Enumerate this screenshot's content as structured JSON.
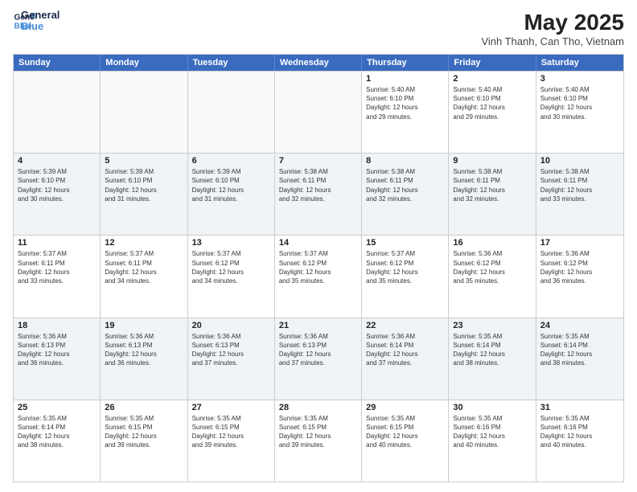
{
  "logo": {
    "line1": "General",
    "line2": "Blue"
  },
  "title": "May 2025",
  "subtitle": "Vinh Thanh, Can Tho, Vietnam",
  "day_headers": [
    "Sunday",
    "Monday",
    "Tuesday",
    "Wednesday",
    "Thursday",
    "Friday",
    "Saturday"
  ],
  "weeks": [
    [
      {
        "day": "",
        "detail": ""
      },
      {
        "day": "",
        "detail": ""
      },
      {
        "day": "",
        "detail": ""
      },
      {
        "day": "",
        "detail": ""
      },
      {
        "day": "1",
        "detail": "Sunrise: 5:40 AM\nSunset: 6:10 PM\nDaylight: 12 hours\nand 29 minutes."
      },
      {
        "day": "2",
        "detail": "Sunrise: 5:40 AM\nSunset: 6:10 PM\nDaylight: 12 hours\nand 29 minutes."
      },
      {
        "day": "3",
        "detail": "Sunrise: 5:40 AM\nSunset: 6:10 PM\nDaylight: 12 hours\nand 30 minutes."
      }
    ],
    [
      {
        "day": "4",
        "detail": "Sunrise: 5:39 AM\nSunset: 6:10 PM\nDaylight: 12 hours\nand 30 minutes."
      },
      {
        "day": "5",
        "detail": "Sunrise: 5:39 AM\nSunset: 6:10 PM\nDaylight: 12 hours\nand 31 minutes."
      },
      {
        "day": "6",
        "detail": "Sunrise: 5:39 AM\nSunset: 6:10 PM\nDaylight: 12 hours\nand 31 minutes."
      },
      {
        "day": "7",
        "detail": "Sunrise: 5:38 AM\nSunset: 6:11 PM\nDaylight: 12 hours\nand 32 minutes."
      },
      {
        "day": "8",
        "detail": "Sunrise: 5:38 AM\nSunset: 6:11 PM\nDaylight: 12 hours\nand 32 minutes."
      },
      {
        "day": "9",
        "detail": "Sunrise: 5:38 AM\nSunset: 6:11 PM\nDaylight: 12 hours\nand 32 minutes."
      },
      {
        "day": "10",
        "detail": "Sunrise: 5:38 AM\nSunset: 6:11 PM\nDaylight: 12 hours\nand 33 minutes."
      }
    ],
    [
      {
        "day": "11",
        "detail": "Sunrise: 5:37 AM\nSunset: 6:11 PM\nDaylight: 12 hours\nand 33 minutes."
      },
      {
        "day": "12",
        "detail": "Sunrise: 5:37 AM\nSunset: 6:11 PM\nDaylight: 12 hours\nand 34 minutes."
      },
      {
        "day": "13",
        "detail": "Sunrise: 5:37 AM\nSunset: 6:12 PM\nDaylight: 12 hours\nand 34 minutes."
      },
      {
        "day": "14",
        "detail": "Sunrise: 5:37 AM\nSunset: 6:12 PM\nDaylight: 12 hours\nand 35 minutes."
      },
      {
        "day": "15",
        "detail": "Sunrise: 5:37 AM\nSunset: 6:12 PM\nDaylight: 12 hours\nand 35 minutes."
      },
      {
        "day": "16",
        "detail": "Sunrise: 5:36 AM\nSunset: 6:12 PM\nDaylight: 12 hours\nand 35 minutes."
      },
      {
        "day": "17",
        "detail": "Sunrise: 5:36 AM\nSunset: 6:12 PM\nDaylight: 12 hours\nand 36 minutes."
      }
    ],
    [
      {
        "day": "18",
        "detail": "Sunrise: 5:36 AM\nSunset: 6:13 PM\nDaylight: 12 hours\nand 36 minutes."
      },
      {
        "day": "19",
        "detail": "Sunrise: 5:36 AM\nSunset: 6:13 PM\nDaylight: 12 hours\nand 36 minutes."
      },
      {
        "day": "20",
        "detail": "Sunrise: 5:36 AM\nSunset: 6:13 PM\nDaylight: 12 hours\nand 37 minutes."
      },
      {
        "day": "21",
        "detail": "Sunrise: 5:36 AM\nSunset: 6:13 PM\nDaylight: 12 hours\nand 37 minutes."
      },
      {
        "day": "22",
        "detail": "Sunrise: 5:36 AM\nSunset: 6:14 PM\nDaylight: 12 hours\nand 37 minutes."
      },
      {
        "day": "23",
        "detail": "Sunrise: 5:35 AM\nSunset: 6:14 PM\nDaylight: 12 hours\nand 38 minutes."
      },
      {
        "day": "24",
        "detail": "Sunrise: 5:35 AM\nSunset: 6:14 PM\nDaylight: 12 hours\nand 38 minutes."
      }
    ],
    [
      {
        "day": "25",
        "detail": "Sunrise: 5:35 AM\nSunset: 6:14 PM\nDaylight: 12 hours\nand 38 minutes."
      },
      {
        "day": "26",
        "detail": "Sunrise: 5:35 AM\nSunset: 6:15 PM\nDaylight: 12 hours\nand 39 minutes."
      },
      {
        "day": "27",
        "detail": "Sunrise: 5:35 AM\nSunset: 6:15 PM\nDaylight: 12 hours\nand 39 minutes."
      },
      {
        "day": "28",
        "detail": "Sunrise: 5:35 AM\nSunset: 6:15 PM\nDaylight: 12 hours\nand 39 minutes."
      },
      {
        "day": "29",
        "detail": "Sunrise: 5:35 AM\nSunset: 6:15 PM\nDaylight: 12 hours\nand 40 minutes."
      },
      {
        "day": "30",
        "detail": "Sunrise: 5:35 AM\nSunset: 6:16 PM\nDaylight: 12 hours\nand 40 minutes."
      },
      {
        "day": "31",
        "detail": "Sunrise: 5:35 AM\nSunset: 6:16 PM\nDaylight: 12 hours\nand 40 minutes."
      }
    ]
  ]
}
